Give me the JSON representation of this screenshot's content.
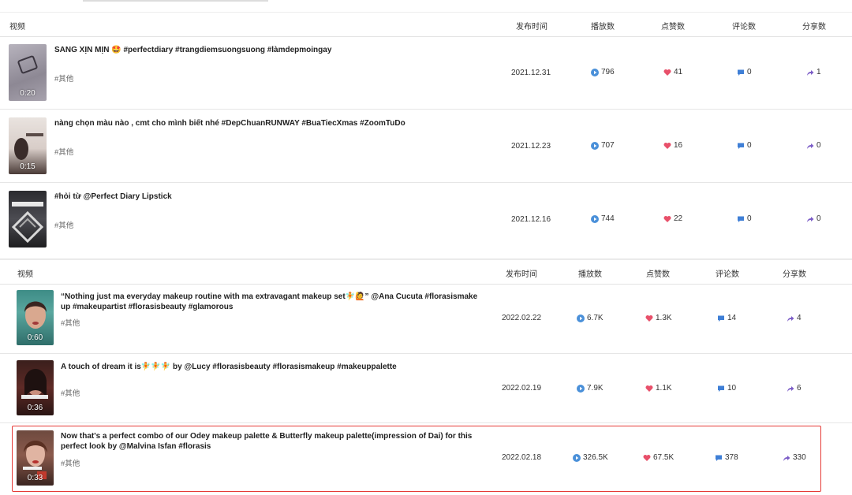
{
  "colors": {
    "play": "#4a90d9",
    "like": "#e8506a",
    "comment": "#3f7fd6",
    "share": "#7b5cc7",
    "highlight": "#e53935"
  },
  "headers": {
    "video": "视频",
    "date": "发布时间",
    "plays": "播放数",
    "likes": "点赞数",
    "comments": "评论数",
    "shares": "分享数"
  },
  "table1": {
    "rows": [
      {
        "duration": "0:20",
        "title": "SANG XỊN MỊN 🤩 #perfectdiary #trangdiemsuongsuong #làmdepmoingay",
        "tag": "#其他",
        "date": "2021.12.31",
        "plays": "796",
        "likes": "41",
        "comments": "0",
        "shares": "1"
      },
      {
        "duration": "0:15",
        "title": "nàng chọn màu nào , cmt cho mình biết nhé #DepChuanRUNWAY #BuaTiecXmas #ZoomTuDo",
        "tag": "#其他",
        "date": "2021.12.23",
        "plays": "707",
        "likes": "16",
        "comments": "0",
        "shares": "0"
      },
      {
        "duration": "",
        "title": "#hỏi từ @Perfect Diary Lipstick",
        "tag": "#其他",
        "date": "2021.12.16",
        "plays": "744",
        "likes": "22",
        "comments": "0",
        "shares": "0"
      }
    ]
  },
  "table2": {
    "rows": [
      {
        "duration": "0:60",
        "title_line1": "“Nothing just ma everyday makeup routine with ma extravagant makeup set🧚🙋” @Ana Cucuta #florasismake",
        "title_line2": "up #makeupartist #florasisbeauty #glamorous",
        "tag": "#其他",
        "date": "2022.02.22",
        "plays": "6.7K",
        "likes": "1.3K",
        "comments": "14",
        "shares": "4"
      },
      {
        "duration": "0:36",
        "title_line1": "A touch of dream it is🧚🧚🧚 by @Lucy #florasisbeauty #florasismakeup #makeuppalette",
        "title_line2": "",
        "tag": "#其他",
        "date": "2022.02.19",
        "plays": "7.9K",
        "likes": "1.1K",
        "comments": "10",
        "shares": "6"
      },
      {
        "duration": "0:33",
        "title_line1": "Now that's a perfect combo of our Odey makeup palette & Butterfly makeup palette(impression of Dai) for this",
        "title_line2": "perfect look by @Malvina Isfan #florasis",
        "tag": "#其他",
        "date": "2022.02.18",
        "plays": "326.5K",
        "likes": "67.5K",
        "comments": "378",
        "shares": "330"
      }
    ]
  }
}
